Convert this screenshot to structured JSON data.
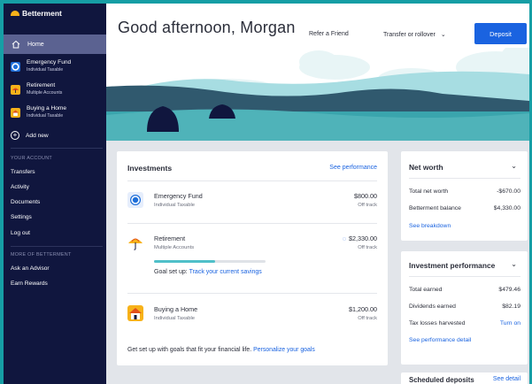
{
  "sidebar": {
    "logo": "Betterment",
    "home": "Home",
    "goals": [
      {
        "name": "Emergency Fund",
        "sub": "Individual Taxable"
      },
      {
        "name": "Retirement",
        "sub": "Multiple Accounts"
      },
      {
        "name": "Buying a Home",
        "sub": "Individual Taxable"
      }
    ],
    "add_new": "Add new",
    "your_account_label": "YOUR ACCOUNT",
    "account_items": [
      "Transfers",
      "Activity",
      "Documents",
      "Settings",
      "Log out"
    ],
    "more_label": "MORE OF BETTERMENT",
    "more_items": [
      "Ask an Advisor",
      "Earn Rewards"
    ]
  },
  "header": {
    "greeting": "Good afternoon, Morgan",
    "refer": "Refer a Friend",
    "transfer": "Transfer or rollover",
    "deposit": "Deposit"
  },
  "investments": {
    "title": "Investments",
    "see_performance": "See performance",
    "rows": [
      {
        "name": "Emergency Fund",
        "sub": "Individual Taxable",
        "amount": "$800.00",
        "status": "Off track"
      },
      {
        "name": "Retirement",
        "sub": "Multiple Accounts",
        "amount": "$2,330.00",
        "status": "Off track",
        "progress": 0.55
      },
      {
        "name": "Buying a Home",
        "sub": "Individual Taxable",
        "amount": "$1,200.00",
        "status": "Off track"
      }
    ],
    "goal_setup_prefix": "Goal set up:",
    "goal_setup_link": "Track your current savings",
    "footer_text": "Get set up with goals that fit your financial life.",
    "footer_link": "Personalize your goals"
  },
  "net_worth": {
    "title": "Net worth",
    "total_label": "Total net worth",
    "total_value": "-$670.00",
    "balance_label": "Betterment balance",
    "balance_value": "$4,330.00",
    "breakdown_link": "See breakdown"
  },
  "investment_performance": {
    "title": "Investment performance",
    "earned_label": "Total earned",
    "earned_value": "$479.46",
    "dividends_label": "Dividends earned",
    "dividends_value": "$82.19",
    "tlh_label": "Tax losses harvested",
    "tlh_value": "Turn on",
    "detail_link": "See performance detail"
  },
  "scheduled": {
    "title": "Scheduled deposits",
    "link": "See detail"
  },
  "colors": {
    "sidebar_bg": "#10163e",
    "sidebar_active": "#5b6291",
    "brand_teal": "#169ea5",
    "accent_blue": "#1a63e0",
    "logo_yellow": "#f7b21a"
  }
}
